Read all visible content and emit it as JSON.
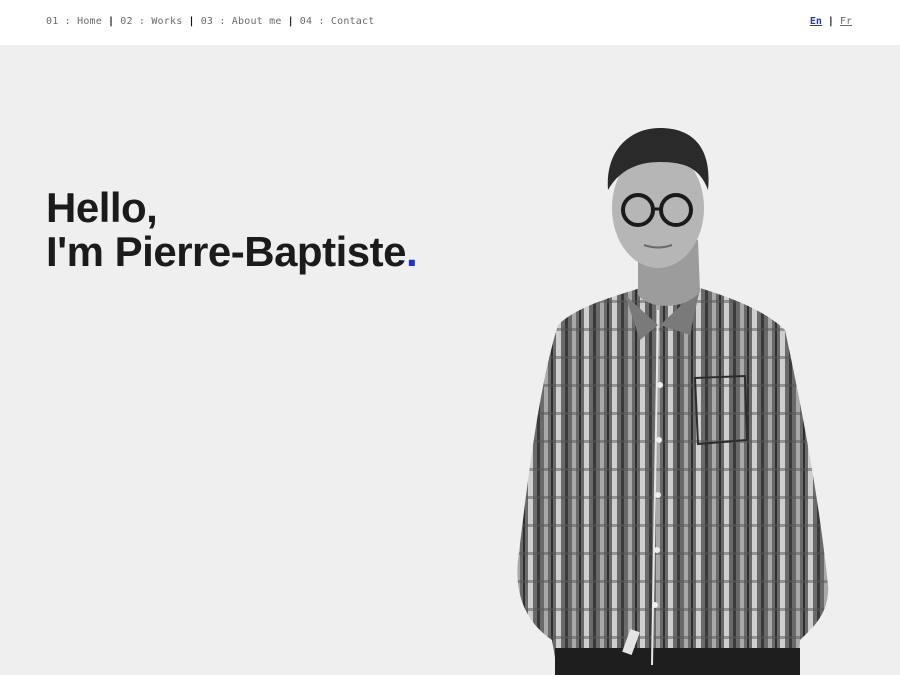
{
  "nav": {
    "items": [
      {
        "label": "01 : Home"
      },
      {
        "label": "02 : Works"
      },
      {
        "label": "03 : About me"
      },
      {
        "label": "04 : Contact"
      }
    ],
    "separator": "|"
  },
  "language": {
    "active": "En",
    "other": "Fr",
    "separator": "|",
    "accent_color": "#1f35c8"
  },
  "hero": {
    "line1": "Hello,",
    "line2": "I'm Pierre-Baptiste",
    "dot": ".",
    "dot_color": "#1a2fe8"
  },
  "portrait": {
    "label": "black-and-white photo of a man in glasses and a striped shirt"
  },
  "colors": {
    "background": "#efefef",
    "header": "#ffffff",
    "text": "#1b1b1b"
  }
}
